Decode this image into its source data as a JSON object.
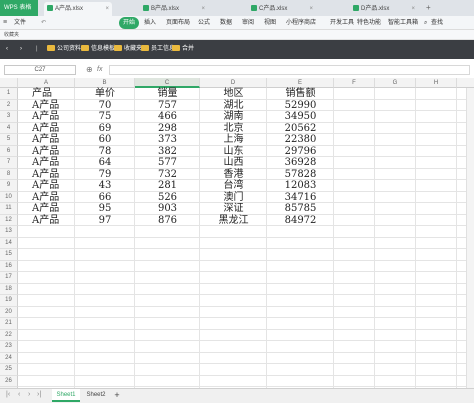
{
  "window": {
    "app_tab": "WPS 表格"
  },
  "file_tabs": [
    {
      "label": "A产品.xlsx",
      "active": true
    },
    {
      "label": "B产品.xlsx",
      "active": false
    },
    {
      "label": "C产品.xlsx",
      "active": false
    },
    {
      "label": "D产品.xlsx",
      "active": false
    }
  ],
  "menu": {
    "file": "文件",
    "items": [
      "开始",
      "插入",
      "页面布局",
      "公式",
      "数据",
      "审阅",
      "视图",
      "小程序商店",
      "开发工具",
      "特色功能",
      "智能工具箱"
    ],
    "search": "查找"
  },
  "ribbon_label": "收藏夹",
  "favorites": [
    "公司资料",
    "信息模板",
    "收藏夹",
    "员工信息",
    "合并"
  ],
  "formula_bar": {
    "cell_ref": "C27",
    "fx": "fx",
    "value": ""
  },
  "columns": [
    "A",
    "B",
    "C",
    "D",
    "E",
    "F",
    "G",
    "H",
    "I"
  ],
  "selected_column": "C",
  "rows": [
    "1",
    "2",
    "3",
    "4",
    "5",
    "6",
    "7",
    "8",
    "9",
    "10",
    "11",
    "12",
    "13",
    "14",
    "15",
    "16",
    "17",
    "18",
    "19",
    "20",
    "21",
    "22",
    "23",
    "24",
    "25",
    "26",
    "27"
  ],
  "table": {
    "headers": [
      "产品",
      "单价",
      "销量",
      "地区",
      "销售额"
    ],
    "rows": [
      [
        "A产品",
        "70",
        "757",
        "湖北",
        "52990"
      ],
      [
        "A产品",
        "75",
        "466",
        "湖南",
        "34950"
      ],
      [
        "A产品",
        "69",
        "298",
        "北京",
        "20562"
      ],
      [
        "A产品",
        "60",
        "373",
        "上海",
        "22380"
      ],
      [
        "A产品",
        "78",
        "382",
        "山东",
        "29796"
      ],
      [
        "A产品",
        "64",
        "577",
        "山西",
        "36928"
      ],
      [
        "A产品",
        "79",
        "732",
        "香港",
        "57828"
      ],
      [
        "A产品",
        "43",
        "281",
        "台湾",
        "12083"
      ],
      [
        "A产品",
        "66",
        "526",
        "澳门",
        "34716"
      ],
      [
        "A产品",
        "95",
        "903",
        "深证",
        "85785"
      ],
      [
        "A产品",
        "97",
        "876",
        "黑龙江",
        "84972"
      ]
    ]
  },
  "sheets": [
    {
      "label": "Sheet1",
      "active": true
    },
    {
      "label": "Sheet2",
      "active": false
    }
  ],
  "add_sheet": "+",
  "colors": {
    "accent": "#2fa866",
    "favbar": "#3b3e43"
  }
}
